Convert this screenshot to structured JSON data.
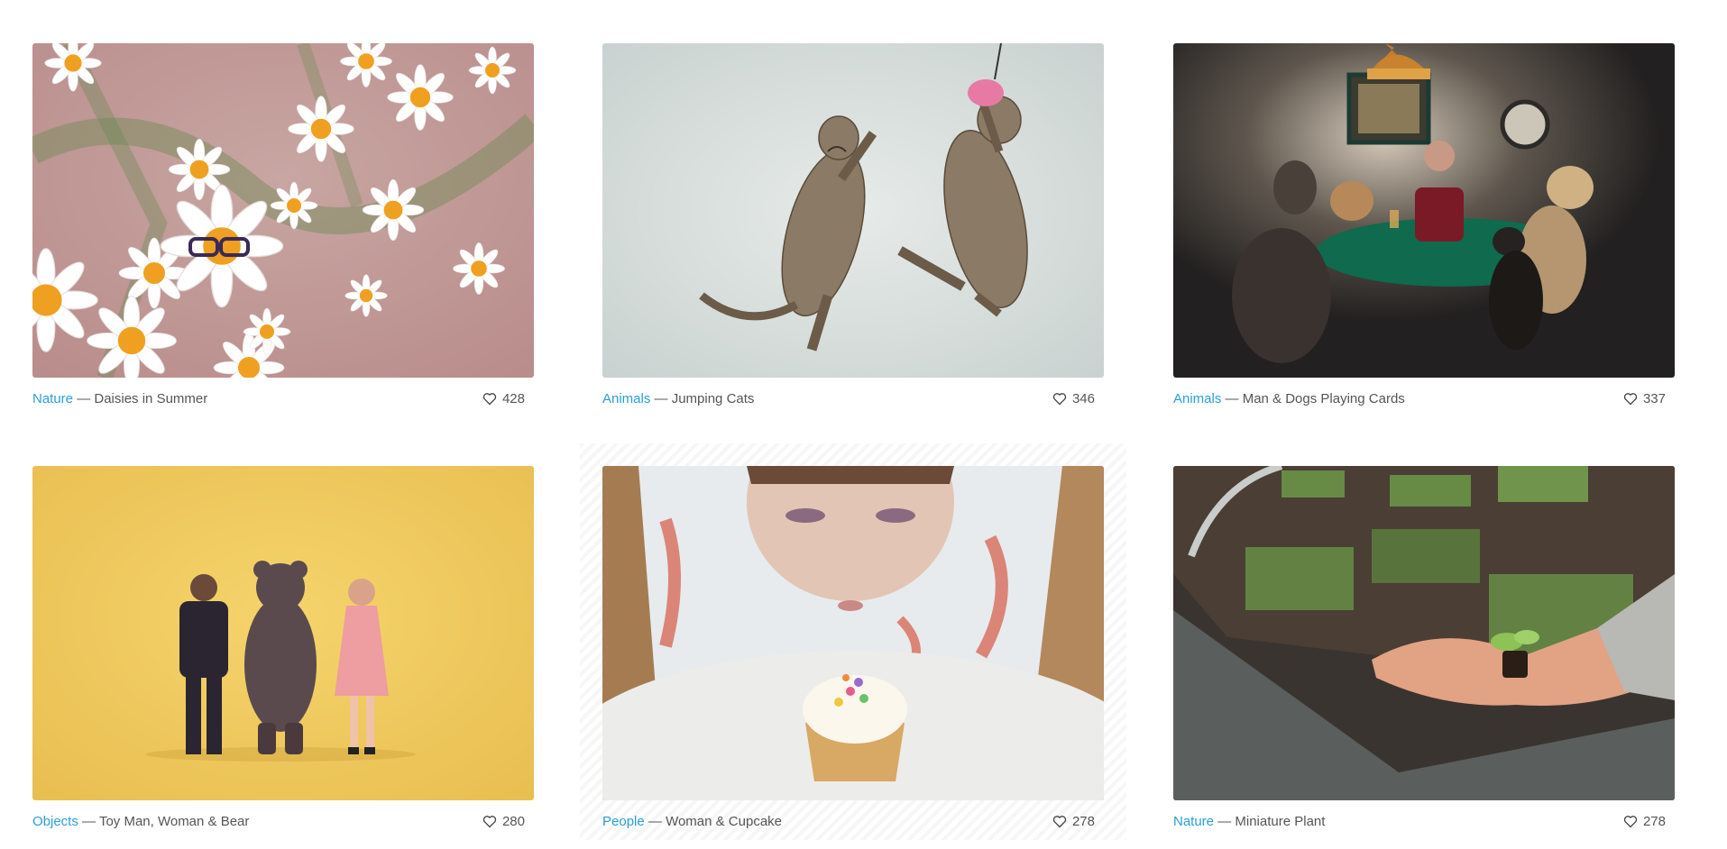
{
  "gallery": {
    "items": [
      {
        "category": "Nature",
        "title": "Daisies in Summer",
        "likes": "428",
        "separator": "—"
      },
      {
        "category": "Animals",
        "title": "Jumping Cats",
        "likes": "346",
        "separator": "—"
      },
      {
        "category": "Animals",
        "title": "Man & Dogs Playing Cards",
        "likes": "337",
        "separator": "—"
      },
      {
        "category": "Objects",
        "title": "Toy Man, Woman & Bear",
        "likes": "280",
        "separator": "—"
      },
      {
        "category": "People",
        "title": "Woman & Cupcake",
        "likes": "278",
        "separator": "—"
      },
      {
        "category": "Nature",
        "title": "Miniature Plant",
        "likes": "278",
        "separator": "—"
      }
    ]
  },
  "colors": {
    "accent": "#2a9fd6",
    "text": "#555555",
    "highlight_pattern": "#f6f6f6"
  },
  "icons": {
    "like": "heart-outline-icon"
  }
}
